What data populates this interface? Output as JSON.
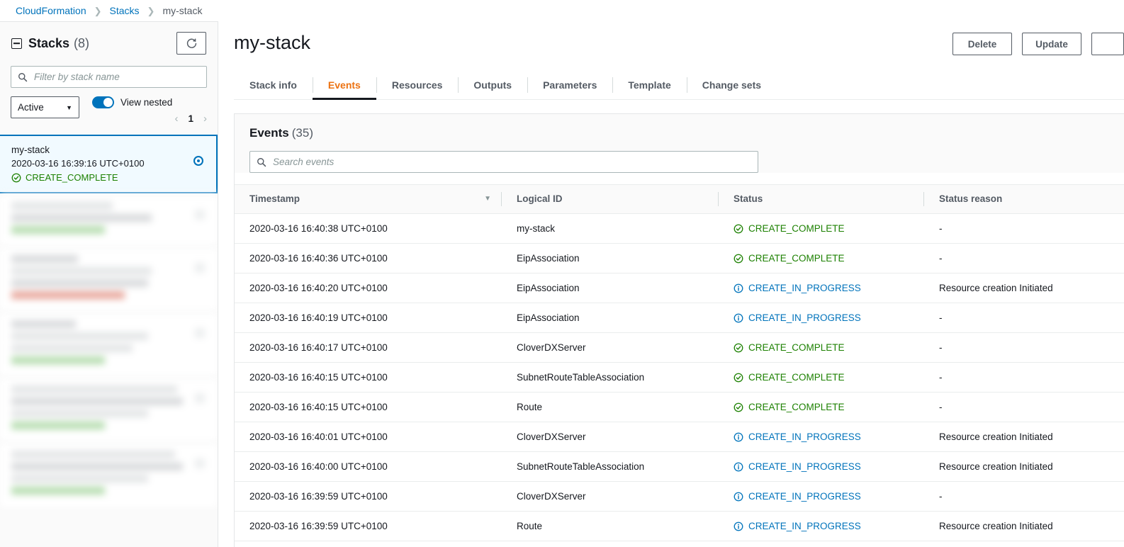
{
  "breadcrumb": {
    "items": [
      {
        "label": "CloudFormation",
        "type": "link"
      },
      {
        "label": "Stacks",
        "type": "link"
      },
      {
        "label": "my-stack",
        "type": "current"
      }
    ],
    "separator": "❯"
  },
  "sidebar": {
    "title": "Stacks",
    "count": "(8)",
    "collapse_icon": "collapse-minus-icon",
    "refresh_icon": "refresh-icon",
    "filter": {
      "placeholder": "Filter by stack name",
      "value": "",
      "icon": "search-icon"
    },
    "status_filter": {
      "value": "Active",
      "caret": "▼"
    },
    "view_nested": {
      "label": "View nested",
      "enabled": true
    },
    "pagination": {
      "prev": "‹",
      "page": "1",
      "next": "›"
    },
    "selected_stack": {
      "name": "my-stack",
      "timestamp": "2020-03-16 16:39:16 UTC+0100",
      "status": "CREATE_COMPLETE",
      "status_icon": "check-circle-icon",
      "radio_icon": "radio-selected-icon"
    },
    "redacted_count": 5
  },
  "header": {
    "title": "my-stack",
    "buttons": [
      {
        "label": "Delete",
        "name": "delete-button"
      },
      {
        "label": "Update",
        "name": "update-button"
      },
      {
        "label": "",
        "name": "stack-actions-button"
      }
    ]
  },
  "tabs": [
    {
      "label": "Stack info",
      "active": false
    },
    {
      "label": "Events",
      "active": true
    },
    {
      "label": "Resources",
      "active": false
    },
    {
      "label": "Outputs",
      "active": false
    },
    {
      "label": "Parameters",
      "active": false
    },
    {
      "label": "Template",
      "active": false
    },
    {
      "label": "Change sets",
      "active": false
    }
  ],
  "events_panel": {
    "title": "Events",
    "count": "(35)",
    "search": {
      "placeholder": "Search events",
      "value": "",
      "icon": "search-icon"
    },
    "columns": [
      {
        "label": "Timestamp",
        "sorted": true,
        "sort_caret": "▼"
      },
      {
        "label": "Logical ID",
        "sorted": false
      },
      {
        "label": "Status",
        "sorted": false
      },
      {
        "label": "Status reason",
        "sorted": false
      }
    ],
    "rows": [
      {
        "timestamp": "2020-03-16 16:40:38 UTC+0100",
        "logical_id": "my-stack",
        "status": "CREATE_COMPLETE",
        "status_kind": "complete",
        "status_reason": "-"
      },
      {
        "timestamp": "2020-03-16 16:40:36 UTC+0100",
        "logical_id": "EipAssociation",
        "status": "CREATE_COMPLETE",
        "status_kind": "complete",
        "status_reason": "-"
      },
      {
        "timestamp": "2020-03-16 16:40:20 UTC+0100",
        "logical_id": "EipAssociation",
        "status": "CREATE_IN_PROGRESS",
        "status_kind": "progress",
        "status_reason": "Resource creation Initiated"
      },
      {
        "timestamp": "2020-03-16 16:40:19 UTC+0100",
        "logical_id": "EipAssociation",
        "status": "CREATE_IN_PROGRESS",
        "status_kind": "progress",
        "status_reason": "-"
      },
      {
        "timestamp": "2020-03-16 16:40:17 UTC+0100",
        "logical_id": "CloverDXServer",
        "status": "CREATE_COMPLETE",
        "status_kind": "complete",
        "status_reason": "-"
      },
      {
        "timestamp": "2020-03-16 16:40:15 UTC+0100",
        "logical_id": "SubnetRouteTableAssociation",
        "status": "CREATE_COMPLETE",
        "status_kind": "complete",
        "status_reason": "-"
      },
      {
        "timestamp": "2020-03-16 16:40:15 UTC+0100",
        "logical_id": "Route",
        "status": "CREATE_COMPLETE",
        "status_kind": "complete",
        "status_reason": "-"
      },
      {
        "timestamp": "2020-03-16 16:40:01 UTC+0100",
        "logical_id": "CloverDXServer",
        "status": "CREATE_IN_PROGRESS",
        "status_kind": "progress",
        "status_reason": "Resource creation Initiated"
      },
      {
        "timestamp": "2020-03-16 16:40:00 UTC+0100",
        "logical_id": "SubnetRouteTableAssociation",
        "status": "CREATE_IN_PROGRESS",
        "status_kind": "progress",
        "status_reason": "Resource creation Initiated"
      },
      {
        "timestamp": "2020-03-16 16:39:59 UTC+0100",
        "logical_id": "CloverDXServer",
        "status": "CREATE_IN_PROGRESS",
        "status_kind": "progress",
        "status_reason": "-"
      },
      {
        "timestamp": "2020-03-16 16:39:59 UTC+0100",
        "logical_id": "Route",
        "status": "CREATE_IN_PROGRESS",
        "status_kind": "progress",
        "status_reason": "Resource creation Initiated"
      }
    ]
  },
  "colors": {
    "link": "#0073bb",
    "accent_active_tab": "#ec7211",
    "status_complete": "#1d8102",
    "status_progress": "#0073bb",
    "border": "#eaeded",
    "text": "#16191f",
    "muted_text": "#545b64"
  }
}
